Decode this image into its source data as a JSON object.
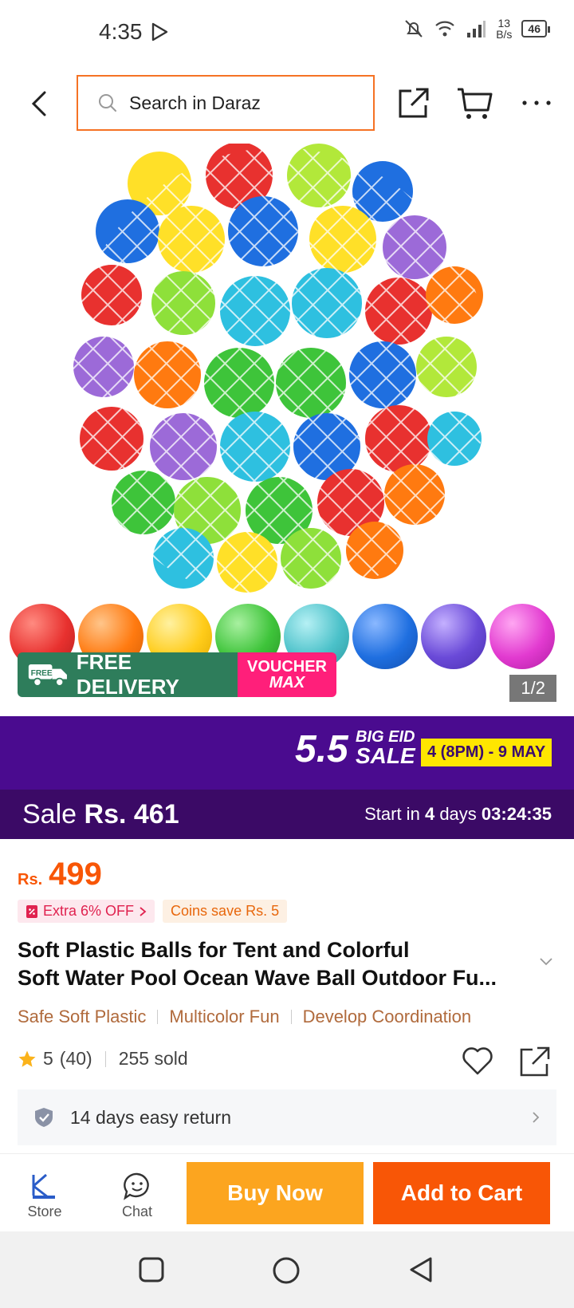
{
  "status_bar": {
    "time": "4:35",
    "net_speed_value": "13",
    "net_speed_unit": "B/s",
    "battery": "46"
  },
  "header": {
    "search_placeholder": "Search in Daraz"
  },
  "gallery": {
    "free_delivery_label": "FREE DELIVERY",
    "free_badge": "FREE",
    "voucher_line1": "VOUCHER",
    "voucher_line2": "MAX",
    "pager": "1/2",
    "ball_colors": [
      "#e8312f",
      "#ff7a10",
      "#ffcc1a",
      "#3ec43a",
      "#4bc1c9",
      "#1f6fe0",
      "#6a4ad8",
      "#e23ad0"
    ]
  },
  "sale_banner": {
    "big": "5.5",
    "eid_line1": "BIG EID",
    "eid_line2": "SALE",
    "dates": "4 (8PM) - 9 MAY"
  },
  "sale_price": {
    "label": "Sale",
    "price": "Rs. 461",
    "start_prefix": "Start in",
    "start_days": "4",
    "start_days_unit": "days",
    "countdown": "03:24:35"
  },
  "product": {
    "currency": "Rs.",
    "price": "499",
    "extra_off": "Extra 6% OFF",
    "coins": "Coins save Rs. 5",
    "title_line1": "Soft Plastic Balls for Tent and Colorful",
    "title_line2": "Soft Water Pool Ocean Wave Ball Outdoor Fu...",
    "tags": [
      "Safe Soft Plastic",
      "Multicolor Fun",
      "Develop Coordination"
    ],
    "rating": "5",
    "reviews": "(40)",
    "sold": "255 sold",
    "returns": "14 days easy return"
  },
  "bottom_bar": {
    "store": "Store",
    "chat": "Chat",
    "buy_now": "Buy Now",
    "add_to_cart": "Add to Cart"
  },
  "colors": {
    "accent": "#f85606",
    "buy_now": "#fca51f",
    "sale_purple": "#4a0b8f"
  }
}
